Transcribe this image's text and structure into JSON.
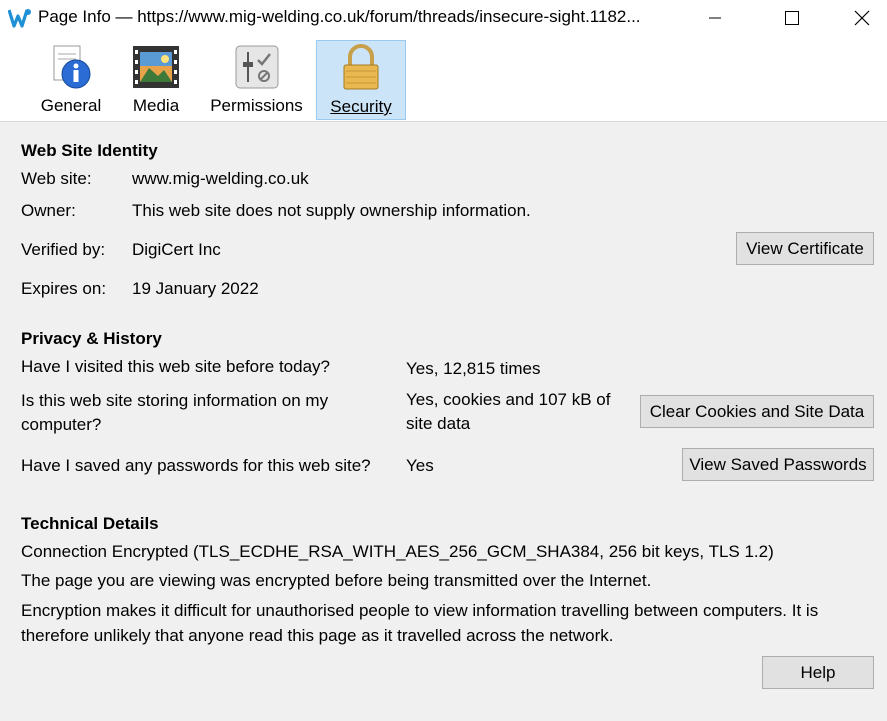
{
  "window": {
    "title": "Page Info — https://www.mig-welding.co.uk/forum/threads/insecure-sight.1182..."
  },
  "tabs": [
    {
      "label": "General",
      "icon": "info-icon"
    },
    {
      "label": "Media",
      "icon": "media-icon"
    },
    {
      "label": "Permissions",
      "icon": "permissions-icon"
    },
    {
      "label": "Security",
      "icon": "padlock-icon",
      "selected": true
    }
  ],
  "identity": {
    "heading": "Web Site Identity",
    "website_label": "Web site:",
    "website_value": "www.mig-welding.co.uk",
    "owner_label": "Owner:",
    "owner_value": "This web site does not supply ownership information.",
    "verified_label": "Verified by:",
    "verified_value": "DigiCert Inc",
    "expires_label": "Expires on:",
    "expires_value": "19 January 2022",
    "view_certificate": "View Certificate"
  },
  "privacy": {
    "heading": "Privacy & History",
    "visited_q": "Have I visited this web site before today?",
    "visited_a": "Yes, 12,815 times",
    "storing_q_line1": "Is this web site storing information on my",
    "storing_q_line2": "computer?",
    "storing_a_line1": "Yes, cookies and 107 kB of",
    "storing_a_line2": "site data",
    "clear_button": "Clear Cookies and Site Data",
    "passwords_q": "Have I saved any passwords for this web site?",
    "passwords_a": "Yes",
    "passwords_button": "View Saved Passwords"
  },
  "technical": {
    "heading": "Technical Details",
    "connection": "Connection Encrypted (TLS_ECDHE_RSA_WITH_AES_256_GCM_SHA384, 256 bit keys, TLS 1.2)",
    "para1": "The page you are viewing was encrypted before being transmitted over the Internet.",
    "para2": "Encryption makes it difficult for unauthorised people to view information travelling between computers. It is therefore unlikely that anyone read this page as it travelled across the network."
  },
  "help_button": "Help",
  "colors": {
    "selected_tab_bg": "#cce4f7",
    "selected_tab_border": "#99c9ef",
    "button_bg": "#e1e1e1",
    "app_icon": "#1e90d6"
  }
}
